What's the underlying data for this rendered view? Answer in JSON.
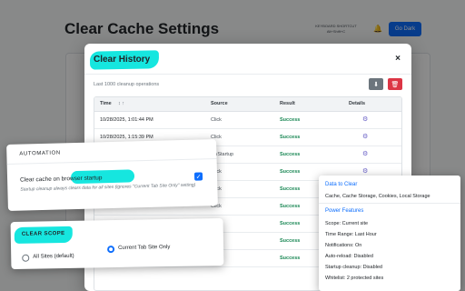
{
  "background": {
    "title": "Clear Cache Settings",
    "shortcut_text": "KEYBOARD SHORTCUT Alt+Shift+C",
    "bell_icon": "bell-icon",
    "go_button": "Go Dark"
  },
  "modal": {
    "title": "Clear History",
    "close": "×",
    "subtitle": "Last 1000 cleanup operations",
    "download_icon": "download-icon",
    "delete_icon": "trash-icon",
    "columns": [
      "Time",
      "Source",
      "Result",
      "Details"
    ],
    "sort_indicator": "↕ ↑",
    "rows": [
      {
        "time": "10/28/2025, 1:01:44 PM",
        "source": "Click",
        "result": "Success",
        "details": "⚙"
      },
      {
        "time": "10/28/2025, 1:15:39 PM",
        "source": "Click",
        "result": "Success",
        "details": "⚙"
      },
      {
        "time": "",
        "source": "OnStartup",
        "result": "Success",
        "details": "⚙"
      },
      {
        "time": "",
        "source": "Click",
        "result": "Success",
        "details": "⚙"
      },
      {
        "time": "",
        "source": "Click",
        "result": "Success",
        "details": "⚙"
      },
      {
        "time": "",
        "source": "Click",
        "result": "Success",
        "details": "⚙"
      },
      {
        "time": "",
        "source": "Click",
        "result": "Success",
        "details": "⚙"
      },
      {
        "time": "",
        "source": "Click",
        "result": "Success",
        "details": "⚙"
      },
      {
        "time": "",
        "source": "Click",
        "result": "Success",
        "details": "⚙"
      }
    ]
  },
  "automation": {
    "title": "AUTOMATION",
    "label_prefix": "Clear cache on ",
    "label_highlight": "browser startup",
    "checked": true,
    "check_glyph": "✓",
    "description": "Startup cleanup always clears data for all sites (ignores \"Current Tab Site Only\" setting)"
  },
  "scope": {
    "title": "CLEAR SCOPE",
    "options": [
      {
        "label": "All Sites (default)",
        "selected": false
      },
      {
        "label": "Current Tab Site Only",
        "selected": true
      }
    ]
  },
  "info_panel": {
    "data_heading": "Data to Clear",
    "data_text": "Cache, Cache Storage, Cookies, Local Storage",
    "power_heading": "Power Features",
    "lines": [
      "Scope: Current site",
      "Time Range: Last Hour",
      "Notifications: On",
      "Auto-reload: Disabled",
      "Startup cleanup: Disabled",
      "Whitelist: 2 protected sites"
    ]
  },
  "colors": {
    "highlight": "#16e6df",
    "primary": "#0d6efd",
    "success": "#198754",
    "danger": "#dc3545"
  }
}
